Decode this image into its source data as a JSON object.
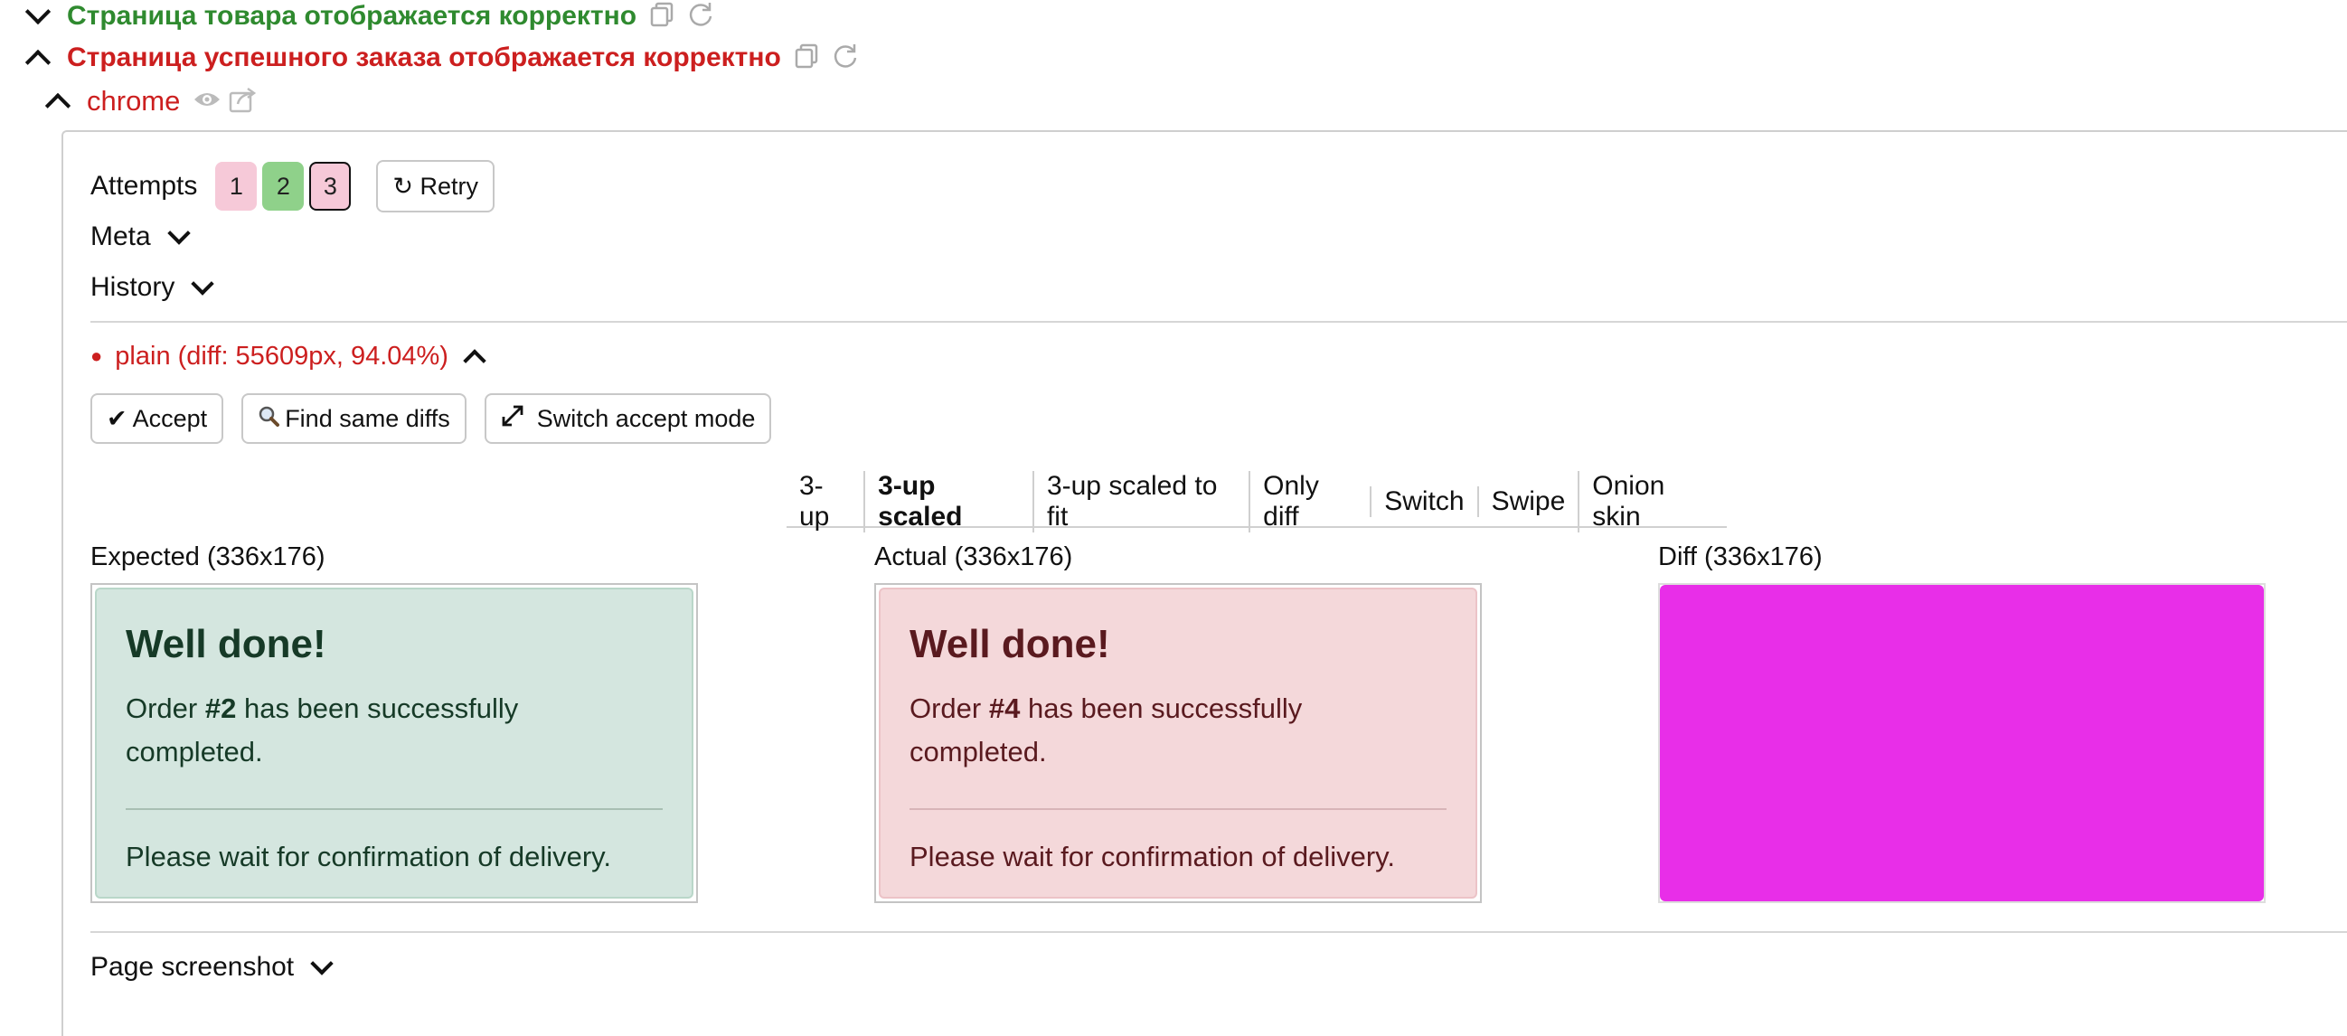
{
  "tree": {
    "item1": {
      "title": "Страница товара отображается корректно",
      "status_color": "#2f8a2f"
    },
    "item2": {
      "title": "Страница успешного заказа отображается корректно",
      "status_color": "#cc1f1f"
    },
    "browser": {
      "name": "chrome"
    }
  },
  "result": {
    "attempts_label": "Attempts",
    "attempts": [
      {
        "number": "1",
        "status": "fail",
        "color": "#f6c9d8"
      },
      {
        "number": "2",
        "status": "success",
        "color": "#8fd18a"
      },
      {
        "number": "3",
        "status": "fail",
        "color": "#f6c9d8",
        "selected": true
      }
    ],
    "retry_label": "↻ Retry",
    "meta_label": "Meta",
    "history_label": "History",
    "state": {
      "bullet": "●",
      "title": "plain (diff: 55609px, 94.04%)",
      "accept_label": "✔ Accept",
      "find_same_label": "Find same diffs",
      "switch_mode_label": "Switch accept mode"
    },
    "view_modes": [
      "3-up",
      "3-up scaled",
      "3-up scaled to fit",
      "Only diff",
      "Switch",
      "Swipe",
      "Onion skin"
    ],
    "active_view_mode": "3-up scaled",
    "images": {
      "expected": {
        "caption": "Expected (336x176)",
        "heading": "Well done!",
        "line1_prefix": "Order ",
        "order_no": "#2",
        "line1_suffix": " has been successfully",
        "line2": "completed.",
        "footer": "Please wait for confirmation of delivery.",
        "bg": "#d4e6df",
        "text": "#163a27"
      },
      "actual": {
        "caption": "Actual (336x176)",
        "heading": "Well done!",
        "line1_prefix": "Order ",
        "order_no": "#4",
        "line1_suffix": " has been successfully",
        "line2": "completed.",
        "footer": "Please wait for confirmation of delivery.",
        "bg": "#f4d8da",
        "text": "#5a1a1f"
      },
      "diff": {
        "caption": "Diff (336x176)",
        "bg": "#e82ee8"
      }
    },
    "page_screenshot_label": "Page screenshot"
  }
}
